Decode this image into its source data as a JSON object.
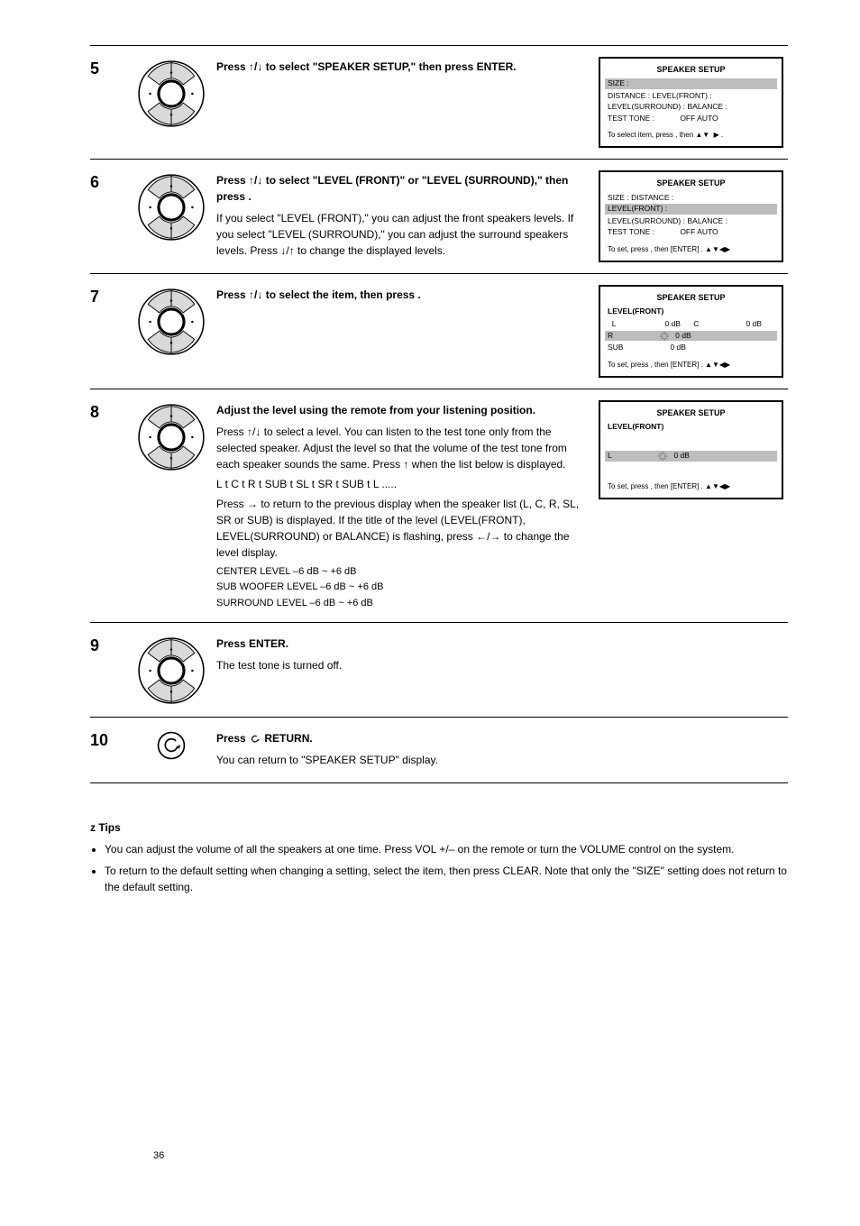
{
  "steps": {
    "s5": {
      "num": "5",
      "title_pre": "Press ",
      "title_post": " to select \"SPEAKER SETUP,\" then press ENTER.",
      "screen": {
        "title": "SPEAKER SETUP",
        "lines": [
          "SIZE :",
          "DISTANCE :",
          "LEVEL(FRONT) :",
          "LEVEL(SURROUND) :",
          "OFF AUTO",
          "BALANCE :",
          "TEST TONE :"
        ],
        "hl_index": 0,
        "foot_pre": "To select item, press      , then ",
        "foot_post": " ."
      }
    },
    "s6": {
      "num": "6",
      "title_pre": "Press ",
      "title_post": " to select \"LEVEL (FRONT)\" or \"LEVEL (SURROUND),\" then press   .",
      "sub_pre": "If you select \"LEVEL (FRONT),\" you can adjust the front speakers levels. If you select \"LEVEL (SURROUND),\" you can adjust the surround speakers levels. Press ",
      "sub_post": " to change the displayed levels.",
      "screen": {
        "title": "SPEAKER SETUP",
        "lines": [
          "SIZE :",
          "DISTANCE :",
          "LEVEL(FRONT) :",
          "LEVEL(SURROUND) :",
          "OFF AUTO",
          "BALANCE :",
          "TEST TONE :"
        ],
        "hl_index": 2,
        "foot": "To set, press             , then [ENTER] ."
      }
    },
    "s7": {
      "num": "7",
      "title_pre": "Press ",
      "title_post": " to select the item, then press   .",
      "screen": {
        "title": "SPEAKER SETUP",
        "subhead": "LEVEL(FRONT)",
        "lines": [
          "0 dB",
          "L",
          "0 dB",
          "     C",
          "0 dB",
          "SUB",
          "R                       0 dB"
        ],
        "hl_text": "L                           0 dB",
        "foot": "To set, press             , then [ENTER] ."
      }
    },
    "s8": {
      "num": "8",
      "title_a": "Adjust the level using the remote from your listening position.",
      "title_b_pre": "Press ",
      "title_b_post": " to select a level. You can listen to the test tone only from the selected speaker. Adjust the level so that the volume of the test tone from each speaker sounds the same. Press ",
      "title_b_post2": " when the list below is displayed.",
      "sequence": "L   t   C   t   R   t   SUB   t   SL   t   SR   t   SUB   t   L .....",
      "press_line_pre": "Press ",
      "press_line_post": " to return to the previous display when the speaker list (L, C, R, SL, SR or SUB) is displayed. If the title of the level (LEVEL(FRONT), LEVEL(SURROUND) or BALANCE) is flashing, press ",
      "press_line_post2": " to change the level display.",
      "levels": [
        "CENTER LEVEL       –6 dB ~ +6 dB",
        "SUB WOOFER LEVEL   –6 dB ~ +6 dB",
        "SURROUND LEVEL     –6 dB ~ +6 dB"
      ],
      "screen": {
        "title": "SPEAKER SETUP",
        "subhead": "LEVEL(FRONT)",
        "hl_text": "L                           0 dB",
        "foot": "To set, press             , then [ENTER] ."
      }
    },
    "s9": {
      "num": "9",
      "title": "Press ENTER.",
      "sub": "The test tone is turned off."
    },
    "s10": {
      "num": "10",
      "title_pre": "Press ",
      "title_post": " RETURN.",
      "sub": "You can return to \"SPEAKER SETUP\" display."
    }
  },
  "tips": {
    "heading": "z Tips",
    "items": [
      "You can adjust the volume of all the speakers at one time. Press VOL +/– on the remote or turn the VOLUME control on the system.",
      "To return to the default setting when changing a setting, select the item, then press CLEAR. Note that only the \"SIZE\" setting does not return to the default setting."
    ]
  },
  "page": "36"
}
